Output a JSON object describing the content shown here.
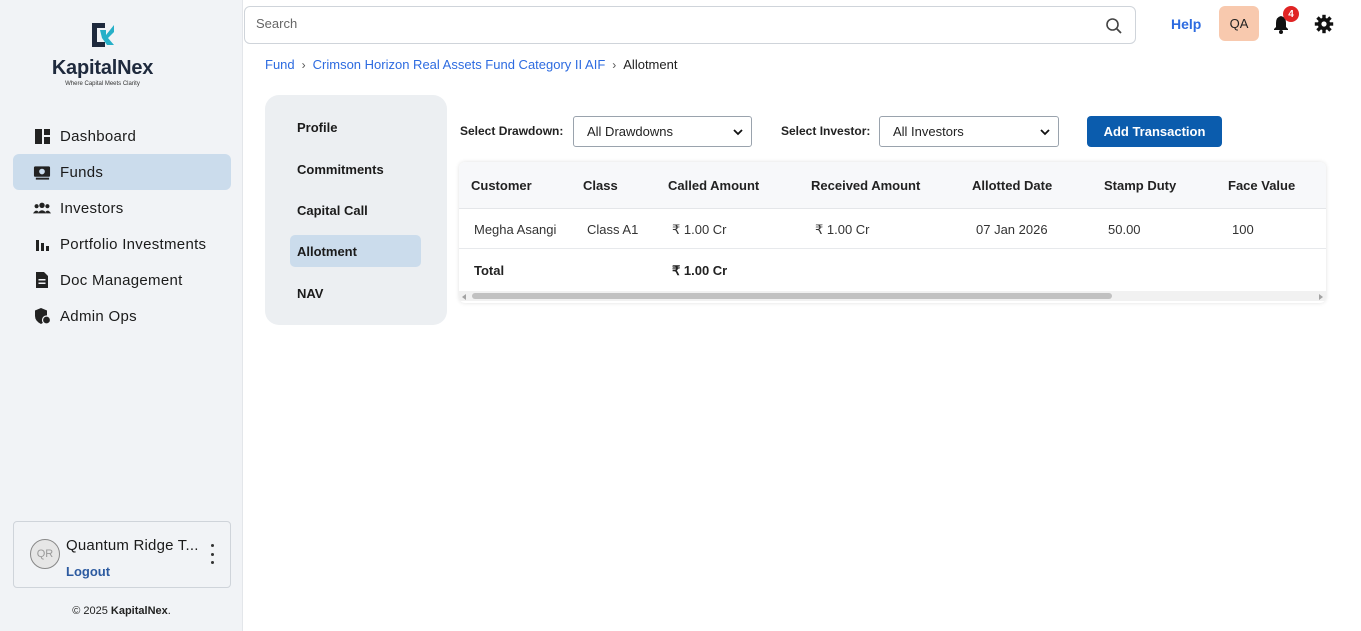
{
  "brand": {
    "name": "KapitalNex",
    "tagline": "Where Capital Meets Clarity",
    "accent": "#0b5cad"
  },
  "sidebar": {
    "items": [
      {
        "label": "Dashboard",
        "icon": "dashboard-icon"
      },
      {
        "label": "Funds",
        "icon": "funds-icon",
        "active": true
      },
      {
        "label": "Investors",
        "icon": "investors-icon"
      },
      {
        "label": "Portfolio Investments",
        "icon": "bar-chart-icon"
      },
      {
        "label": "Doc Management",
        "icon": "document-icon"
      },
      {
        "label": "Admin Ops",
        "icon": "shield-icon"
      }
    ],
    "user": {
      "initials": "QR",
      "name": "Quantum Ridge T...",
      "logout_label": "Logout"
    },
    "copyright_prefix": "© 2025 ",
    "copyright_brand": "KapitalNex",
    "copyright_suffix": "."
  },
  "topbar": {
    "search_placeholder": "Search",
    "help_label": "Help",
    "user_initials": "QA",
    "notification_count": "4"
  },
  "breadcrumb": {
    "items": [
      "Fund",
      "Crimson Horizon Real Assets Fund Category II AIF"
    ],
    "separator": "›",
    "current": "Allotment"
  },
  "subnav": {
    "items": [
      {
        "label": "Profile"
      },
      {
        "label": "Commitments"
      },
      {
        "label": "Capital Call"
      },
      {
        "label": "Allotment",
        "active": true
      },
      {
        "label": "NAV"
      }
    ]
  },
  "filters": {
    "drawdown_label": "Select Drawdown:",
    "drawdown_value": "All Drawdowns",
    "investor_label": "Select Investor:",
    "investor_value": "All Investors",
    "add_button_label": "Add Transaction"
  },
  "table": {
    "columns": [
      "Customer",
      "Class",
      "Called Amount",
      "Received Amount",
      "Allotted Date",
      "Stamp Duty",
      "Face Value"
    ],
    "rows": [
      [
        "Megha Asangi",
        "Class A1",
        "₹ 1.00 Cr",
        "₹ 1.00 Cr",
        "07 Jan 2026",
        "50.00",
        "100"
      ]
    ],
    "total": {
      "label": "Total",
      "called_amount": "₹ 1.00 Cr"
    }
  }
}
